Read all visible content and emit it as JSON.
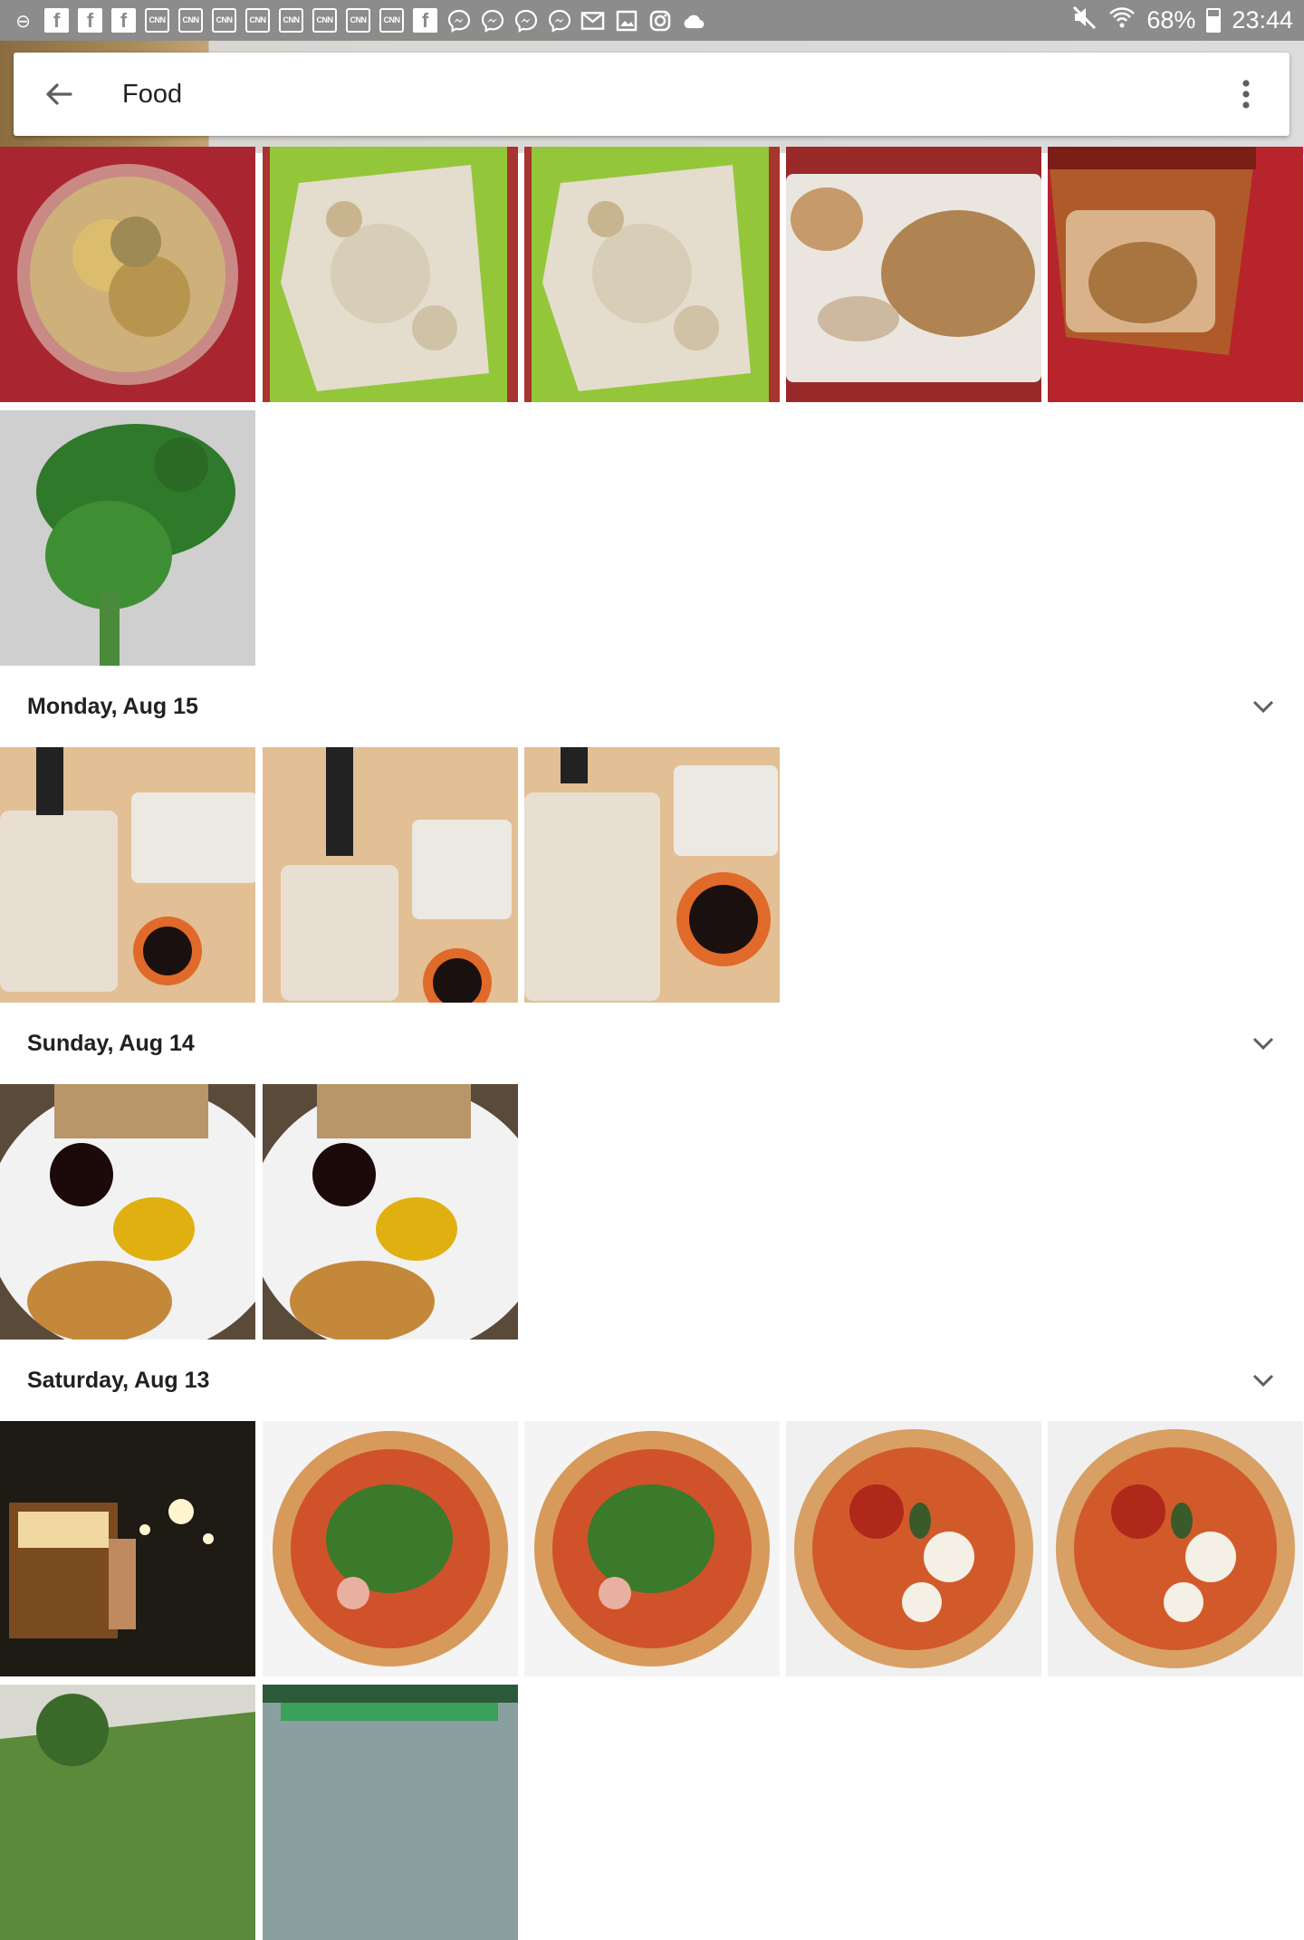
{
  "status_bar": {
    "battery": "68%",
    "time": "23:44",
    "notification_icons": [
      "minus-circle-icon",
      "facebook-icon",
      "facebook-icon",
      "facebook-icon",
      "cnn-icon",
      "cnn-icon",
      "cnn-icon",
      "cnn-icon",
      "cnn-icon",
      "cnn-icon",
      "cnn-icon",
      "cnn-icon",
      "facebook-icon",
      "messenger-icon",
      "messenger-icon",
      "messenger-icon",
      "messenger-icon",
      "gmail-icon",
      "gallery-icon",
      "instagram-icon",
      "cloud-icon"
    ],
    "cnn_label": "CNN",
    "fb_label": "f"
  },
  "app_bar": {
    "title": "Food",
    "back_icon": "back-arrow-icon",
    "menu_icon": "more-vert-icon"
  },
  "sections": [
    {
      "date": "",
      "photos": [
        "blurry-food-bowl",
        "chopped-chicken-green-board",
        "chopped-chicken-green-board",
        "roast-chicken-plate",
        "roast-chicken-bag",
        "parsley-bunch"
      ]
    },
    {
      "date": "Monday, Aug 15",
      "photos": [
        "sushi-set",
        "sushi-set",
        "sushi-set"
      ]
    },
    {
      "date": "Sunday, Aug 14",
      "photos": [
        "plate-garlic-bread-salsa",
        "plate-garlic-bread-salsa"
      ]
    },
    {
      "date": "Saturday, Aug 13",
      "photos": [
        "night-food-stall",
        "pizza-arugula-prosciutto",
        "pizza-arugula-prosciutto",
        "pizza-margherita",
        "pizza-margherita",
        "outdoor-tree-umbrella",
        "outdoor-terrace"
      ]
    }
  ],
  "colors": {
    "status_bar": "#8c8c8c",
    "app_bar": "#ffffff",
    "text_primary": "#212121",
    "icon": "#5f5f5f"
  }
}
